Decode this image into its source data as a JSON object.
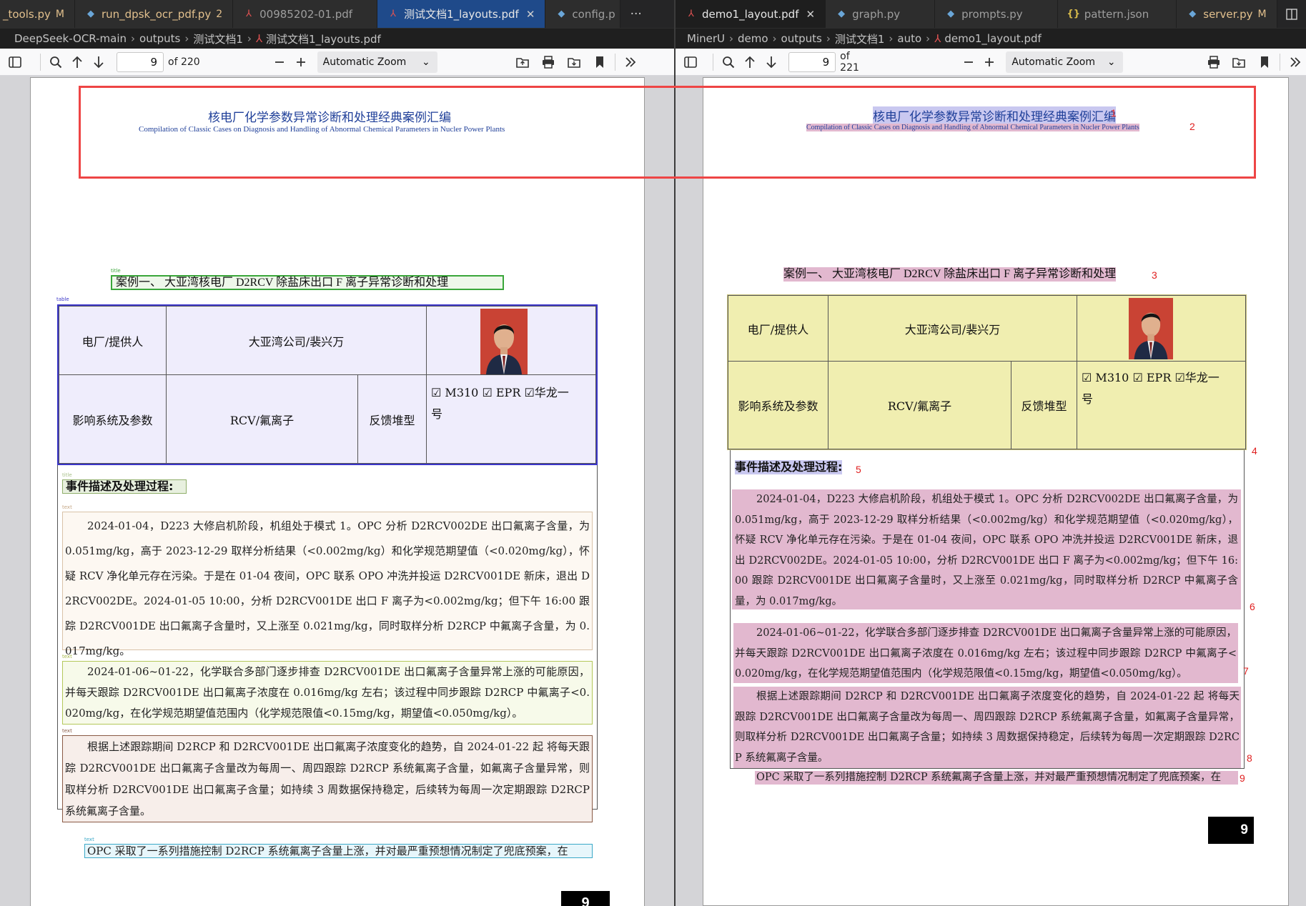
{
  "left": {
    "tabs": [
      {
        "label": "_tools.py",
        "badge": "M",
        "icon": "python-icon",
        "modified": true
      },
      {
        "label": "run_dpsk_ocr_pdf.py",
        "badge": "2",
        "icon": "python-icon",
        "modified": true
      },
      {
        "label": "00985202-01.pdf",
        "badge": "",
        "icon": "pdf-icon",
        "modified": false
      },
      {
        "label": "测试文档1_layouts.pdf",
        "badge": "",
        "icon": "pdf-icon",
        "modified": false,
        "active": true
      },
      {
        "label": "config.p",
        "badge": "",
        "icon": "python-icon",
        "modified": false
      }
    ],
    "more": "···",
    "breadcrumb": [
      "DeepSeek-OCR-main",
      "outputs",
      "测试文档1",
      "测试文档1_layouts.pdf"
    ],
    "page_number": "9",
    "page_total": "of 220",
    "zoom": "Automatic Zoom",
    "doc": {
      "header_cn": "核电厂化学参数异常诊断和处理经典案例汇编",
      "header_en": "Compilation of Classic Cases on Diagnosis and Handling of Abnormal Chemical Parameters in Nucler Power Plants",
      "title_tag": "title",
      "title": "案例一、 大亚湾核电厂 D2RCV 除盐床出口 F 离子异常诊断和处理",
      "table_tag": "table",
      "table": {
        "r1c1": "电厂/提供人",
        "r1c2": "大亚湾公司/裴兴万",
        "r2c1": "影响系统及参数",
        "r2c2": "RCV/氟离子",
        "r2c3": "反馈堆型",
        "r2c4a": "☑ M310 ☑ EPR ☑华龙一",
        "r2c4b": "号"
      },
      "sub_tag": "title",
      "subtitle": "事件描述及处理过程:",
      "text_tag": "text",
      "p1": "2024-01-04，D223 大修启机阶段，机组处于模式 1。OPC 分析 D2RCV002DE 出口氟离子含量，为 0.051mg/kg，高于 2023-12-29 取样分析结果（<0.002mg/kg）和化学规范期望值（<0.020mg/kg），怀疑 RCV 净化单元存在污染。于是在 01-04 夜间，OPC 联系 OPO 冲洗并投运 D2RCV001DE 新床，退出 D2RCV002DE。2024-01-05 10:00，分析 D2RCV001DE 出口 F 离子为<0.002mg/kg；但下午 16:00 跟踪 D2RCV001DE 出口氟离子含量时，又上涨至 0.021mg/kg，同时取样分析 D2RCP 中氟离子含量，为 0.017mg/kg。",
      "p2": "2024-01-06~01-22，化学联合多部门逐步排查 D2RCV001DE 出口氟离子含量异常上涨的可能原因，并每天跟踪 D2RCV001DE 出口氟离子浓度在 0.016mg/kg 左右；该过程中同步跟踪 D2RCP 中氟离子<0.020mg/kg，在化学规范期望值范围内（化学规范限值<0.15mg/kg，期望值<0.050mg/kg）。",
      "p3": "根据上述跟踪期间 D2RCP 和 D2RCV001DE 出口氟离子浓度变化的趋势，自 2024-01-22 起 将每天跟踪 D2RCV001DE 出口氟离子含量改为每周一、周四跟踪 D2RCP 系统氟离子含量，如氟离子含量异常，则取样分析 D2RCV001DE 出口氟离子含量；如持续 3 周数据保持稳定，后续转为每周一次定期跟踪 D2RCP 系统氟离子含量。",
      "p4": "OPC 采取了一系列措施控制 D2RCP 系统氟离子含量上涨，并对最严重预想情况制定了兜底预案，在",
      "pagenum": "9"
    }
  },
  "right": {
    "tabs": [
      {
        "label": "demo1_layout.pdf",
        "badge": "",
        "icon": "pdf-icon",
        "modified": false,
        "active": true
      },
      {
        "label": "graph.py",
        "badge": "",
        "icon": "python-icon",
        "modified": false
      },
      {
        "label": "prompts.py",
        "badge": "",
        "icon": "python-icon",
        "modified": false
      },
      {
        "label": "pattern.json",
        "badge": "",
        "icon": "json-icon",
        "modified": false
      },
      {
        "label": "server.py",
        "badge": "M",
        "icon": "python-icon",
        "modified": true
      }
    ],
    "breadcrumb": [
      "MinerU",
      "demo",
      "outputs",
      "测试文档1",
      "auto",
      "demo1_layout.pdf"
    ],
    "page_number": "9",
    "page_total": "of 221",
    "zoom": "Automatic Zoom",
    "labels": [
      "1",
      "2",
      "3",
      "4",
      "5",
      "6",
      "7",
      "8",
      "9"
    ],
    "pagenum": "9"
  }
}
